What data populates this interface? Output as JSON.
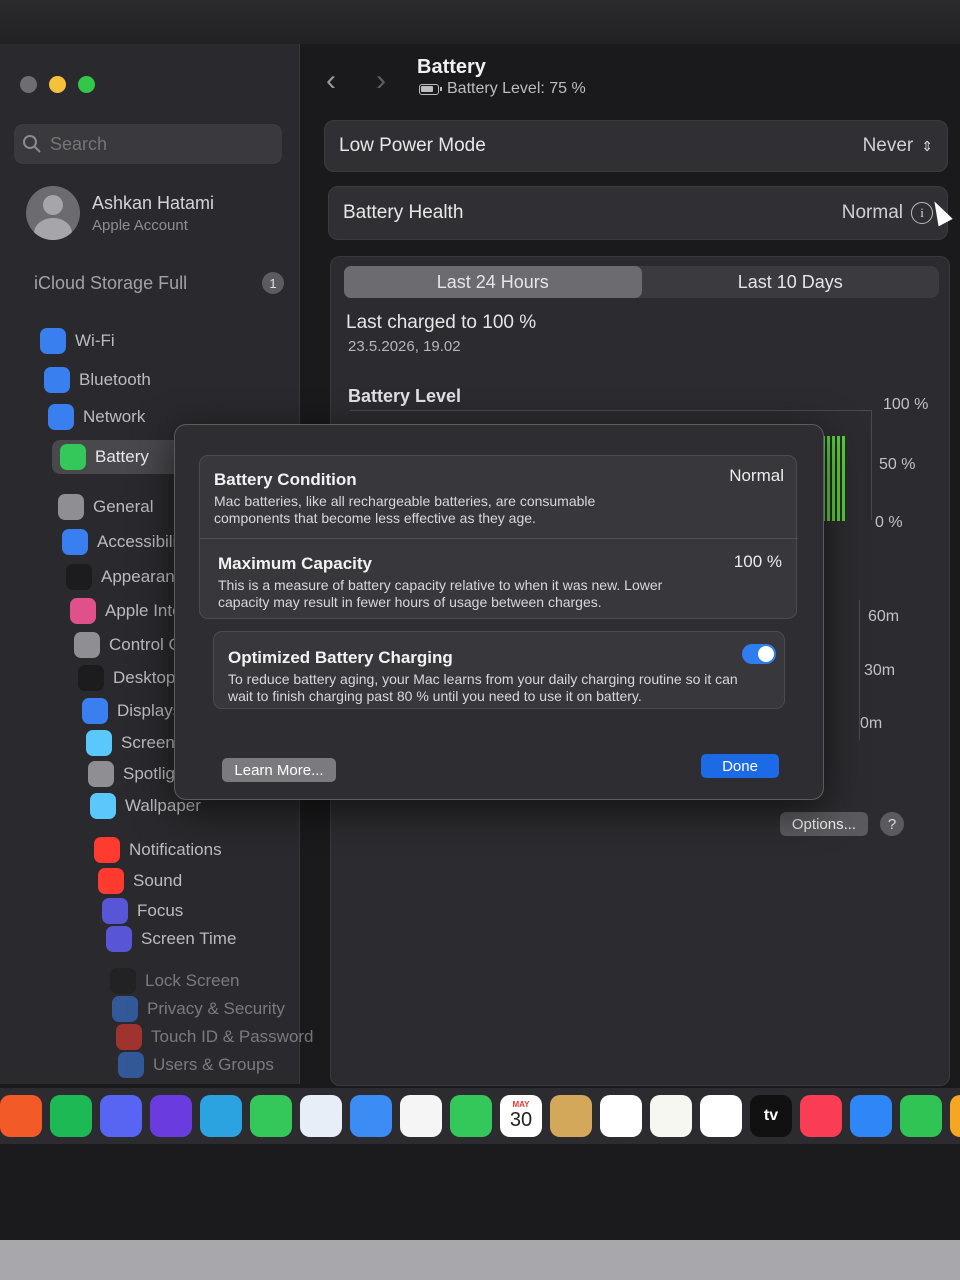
{
  "window": {
    "title": "Battery",
    "subtitle": "Battery Level: 75 %"
  },
  "sidebar": {
    "search_placeholder": "Search",
    "account": {
      "name": "Ashkan Hatami",
      "sub": "Apple Account"
    },
    "icloud": {
      "label": "iCloud Storage Full",
      "badge": "1"
    },
    "items": [
      {
        "label": "Wi-Fi",
        "icon": "wifi-icon",
        "color": "#3a7ff0"
      },
      {
        "label": "Bluetooth",
        "icon": "bluetooth-icon",
        "color": "#3a7ff0"
      },
      {
        "label": "Network",
        "icon": "globe-icon",
        "color": "#3a7ff0"
      },
      {
        "label": "Battery",
        "icon": "battery-icon",
        "color": "#34c759"
      },
      {
        "label": "General",
        "icon": "gear-icon",
        "color": "#8e8e93"
      },
      {
        "label": "Accessibili",
        "icon": "accessibility-icon",
        "color": "#3a7ff0"
      },
      {
        "label": "Appearanc",
        "icon": "appearance-icon",
        "color": "#1c1c1e"
      },
      {
        "label": "Apple Intel",
        "icon": "apple-intelligence-icon",
        "color": "#e0508a"
      },
      {
        "label": "Control Ce",
        "icon": "control-center-icon",
        "color": "#8e8e93"
      },
      {
        "label": "Desktop &",
        "icon": "desktop-dock-icon",
        "color": "#1c1c1e"
      },
      {
        "label": "Displays",
        "icon": "displays-icon",
        "color": "#3a7ff0"
      },
      {
        "label": "Screen Sav",
        "icon": "screensaver-icon",
        "color": "#5ac8fa"
      },
      {
        "label": "Spotlight",
        "icon": "spotlight-icon",
        "color": "#8e8e93"
      },
      {
        "label": "Wallpaper",
        "icon": "wallpaper-icon",
        "color": "#5ac8fa"
      },
      {
        "label": "Notifications",
        "icon": "notifications-icon",
        "color": "#ff3b30"
      },
      {
        "label": "Sound",
        "icon": "sound-icon",
        "color": "#ff3b30"
      },
      {
        "label": "Focus",
        "icon": "focus-icon",
        "color": "#5856d6"
      },
      {
        "label": "Screen Time",
        "icon": "hourglass-icon",
        "color": "#5856d6"
      },
      {
        "label": "Lock Screen",
        "icon": "lock-icon",
        "color": "#1c1c1e"
      },
      {
        "label": "Privacy & Security",
        "icon": "hand-icon",
        "color": "#3a7ff0"
      },
      {
        "label": "Touch ID & Password",
        "icon": "fingerprint-icon",
        "color": "#ff3b30"
      },
      {
        "label": "Users & Groups",
        "icon": "users-icon",
        "color": "#3a7ff0"
      }
    ]
  },
  "main": {
    "low_power": {
      "label": "Low Power Mode",
      "value": "Never"
    },
    "health": {
      "label": "Battery Health",
      "value": "Normal"
    },
    "tabs": [
      "Last 24 Hours",
      "Last 10 Days"
    ],
    "last_charged": "Last charged to 100 %",
    "last_charged_date": "23.5.2026, 19.02",
    "battery_level_title": "Battery Level",
    "level_axis": [
      "100 %",
      "50 %",
      "0 %"
    ],
    "usage_axis": [
      "60m",
      "30m",
      "0m"
    ],
    "options_label": "Options...",
    "help_label": "?"
  },
  "dialog": {
    "condition": {
      "title": "Battery Condition",
      "value": "Normal",
      "desc": "Mac batteries, like all rechargeable batteries, are consumable components that become less effective as they age."
    },
    "capacity": {
      "title": "Maximum Capacity",
      "value": "100 %",
      "desc": "This is a measure of battery capacity relative to when it was new. Lower capacity may result in fewer hours of usage between charges."
    },
    "optimized": {
      "title": "Optimized Battery Charging",
      "enabled": true,
      "desc": "To reduce battery aging, your Mac learns from your daily charging routine so it can wait to finish charging past 80 % until you need to use it on battery."
    },
    "learn_more": "Learn More...",
    "done": "Done"
  },
  "dock": {
    "calendar_month": "MAY",
    "calendar_day": "30",
    "tv_label": "tv",
    "apps": [
      {
        "name": "brave-icon",
        "color": "#f25a28"
      },
      {
        "name": "spotify-icon",
        "color": "#1db954"
      },
      {
        "name": "discord-icon",
        "color": "#5865f2"
      },
      {
        "name": "gifox-icon",
        "color": "#6a3ce0"
      },
      {
        "name": "telegram-icon",
        "color": "#2aa3e0"
      },
      {
        "name": "messages-icon",
        "color": "#34c759"
      },
      {
        "name": "app-store-icon",
        "color": "#e8eef8"
      },
      {
        "name": "mail-icon",
        "color": "#3b8cf5"
      },
      {
        "name": "photos-icon",
        "color": "#f5f5f5"
      },
      {
        "name": "facetime-icon",
        "color": "#34c759"
      },
      {
        "name": "calendar-icon",
        "color": "#ffffff"
      },
      {
        "name": "contacts-icon",
        "color": "#d4a85a"
      },
      {
        "name": "reminders-icon",
        "color": "#ffffff"
      },
      {
        "name": "notes-icon",
        "color": "#f7f7f2"
      },
      {
        "name": "freeform-icon",
        "color": "#ffffff"
      },
      {
        "name": "apple-tv-icon",
        "color": "#111111"
      },
      {
        "name": "music-icon",
        "color": "#fa3c55"
      },
      {
        "name": "keynote-icon",
        "color": "#2f86f6"
      },
      {
        "name": "numbers-icon",
        "color": "#30c454"
      },
      {
        "name": "pages-icon",
        "color": "#f5a623"
      }
    ]
  }
}
